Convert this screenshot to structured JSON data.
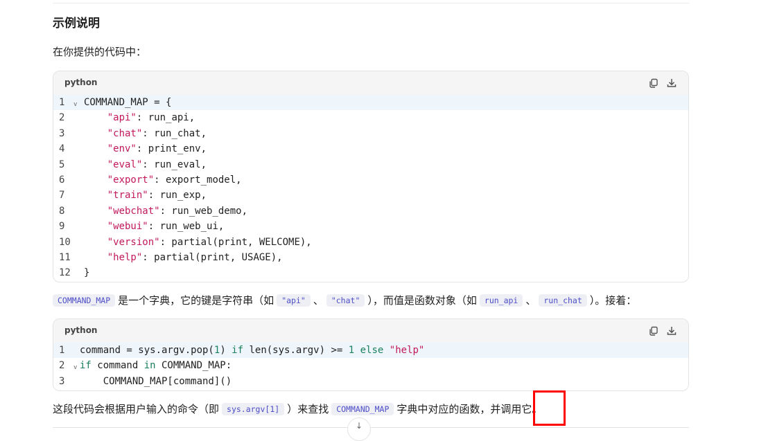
{
  "heading": "示例说明",
  "intro": "在你提供的代码中：",
  "code_block_1": {
    "language": "python",
    "lines": [
      {
        "num": "1",
        "fold": "v",
        "tokens": [
          {
            "t": "COMMAND_MAP = {",
            "c": ""
          }
        ]
      },
      {
        "num": "2",
        "tokens": [
          {
            "t": "    ",
            "c": ""
          },
          {
            "t": "\"api\"",
            "c": "s"
          },
          {
            "t": ": run_api,",
            "c": ""
          }
        ]
      },
      {
        "num": "3",
        "tokens": [
          {
            "t": "    ",
            "c": ""
          },
          {
            "t": "\"chat\"",
            "c": "s"
          },
          {
            "t": ": run_chat,",
            "c": ""
          }
        ]
      },
      {
        "num": "4",
        "tokens": [
          {
            "t": "    ",
            "c": ""
          },
          {
            "t": "\"env\"",
            "c": "s"
          },
          {
            "t": ": print_env,",
            "c": ""
          }
        ]
      },
      {
        "num": "5",
        "tokens": [
          {
            "t": "    ",
            "c": ""
          },
          {
            "t": "\"eval\"",
            "c": "s"
          },
          {
            "t": ": run_eval,",
            "c": ""
          }
        ]
      },
      {
        "num": "6",
        "tokens": [
          {
            "t": "    ",
            "c": ""
          },
          {
            "t": "\"export\"",
            "c": "s"
          },
          {
            "t": ": export_model,",
            "c": ""
          }
        ]
      },
      {
        "num": "7",
        "tokens": [
          {
            "t": "    ",
            "c": ""
          },
          {
            "t": "\"train\"",
            "c": "s"
          },
          {
            "t": ": run_exp,",
            "c": ""
          }
        ]
      },
      {
        "num": "8",
        "tokens": [
          {
            "t": "    ",
            "c": ""
          },
          {
            "t": "\"webchat\"",
            "c": "s"
          },
          {
            "t": ": run_web_demo,",
            "c": ""
          }
        ]
      },
      {
        "num": "9",
        "tokens": [
          {
            "t": "    ",
            "c": ""
          },
          {
            "t": "\"webui\"",
            "c": "s"
          },
          {
            "t": ": run_web_ui,",
            "c": ""
          }
        ]
      },
      {
        "num": "10",
        "tokens": [
          {
            "t": "    ",
            "c": ""
          },
          {
            "t": "\"version\"",
            "c": "s"
          },
          {
            "t": ": partial(print, WELCOME),",
            "c": ""
          }
        ]
      },
      {
        "num": "11",
        "tokens": [
          {
            "t": "    ",
            "c": ""
          },
          {
            "t": "\"help\"",
            "c": "s"
          },
          {
            "t": ": partial(print, USAGE),",
            "c": ""
          }
        ]
      },
      {
        "num": "12",
        "tokens": [
          {
            "t": "}",
            "c": ""
          }
        ]
      }
    ]
  },
  "para2": {
    "code_command_map": "COMMAND_MAP",
    "text1": "是一个字典，它的键是字符串（如",
    "code_api": "\"api\"",
    "sep1": "、",
    "code_chat": "\"chat\"",
    "text2": "），而值是函数对象（如",
    "code_run_api": "run_api",
    "sep2": "、",
    "code_run_chat": "run_chat",
    "text3": "）。接着："
  },
  "code_block_2": {
    "language": "python",
    "lines": [
      {
        "num": "1",
        "tokens": [
          {
            "t": "command = sys.argv.pop(",
            "c": ""
          },
          {
            "t": "1",
            "c": "n"
          },
          {
            "t": ") ",
            "c": ""
          },
          {
            "t": "if",
            "c": "k"
          },
          {
            "t": " len(sys.argv) >= ",
            "c": ""
          },
          {
            "t": "1",
            "c": "n"
          },
          {
            "t": " ",
            "c": ""
          },
          {
            "t": "else",
            "c": "k"
          },
          {
            "t": " ",
            "c": ""
          },
          {
            "t": "\"help\"",
            "c": "s"
          }
        ]
      },
      {
        "num": "2",
        "fold": "v",
        "tokens": [
          {
            "t": "if",
            "c": "k"
          },
          {
            "t": " command ",
            "c": ""
          },
          {
            "t": "in",
            "c": "k"
          },
          {
            "t": " COMMAND_MAP:",
            "c": ""
          }
        ]
      },
      {
        "num": "3",
        "tokens": [
          {
            "t": "    COMMAND_MAP[command]()",
            "c": ""
          }
        ]
      }
    ]
  },
  "para3": {
    "text1": "这段代码会根据用户输入的命令（即",
    "code_argv": "sys.argv[1]",
    "text2": "）来查找",
    "code_command_map": "COMMAND_MAP",
    "text3": "字典中对应的函数，并调用它。"
  },
  "scroll_icon": "arrow-down-icon",
  "highlight_color": "#ff0000"
}
